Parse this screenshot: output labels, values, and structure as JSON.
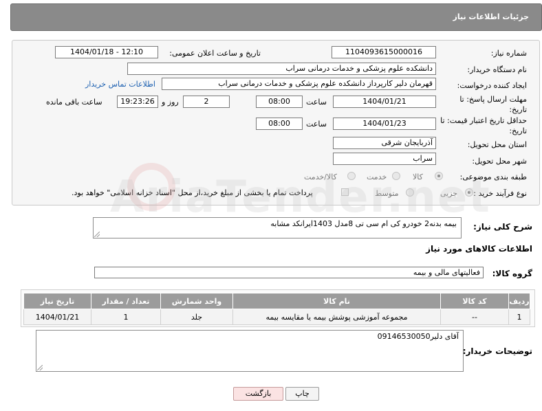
{
  "header": {
    "title": "جزئیات اطلاعات نیاز"
  },
  "form": {
    "need_number_label": "شماره نیاز:",
    "need_number": "1104093615000016",
    "announce_label": "تاریخ و ساعت اعلان عمومی:",
    "announce_value": "1404/01/18 - 12:10",
    "buyer_org_label": "نام دستگاه خریدار:",
    "buyer_org": "دانشکده علوم پزشکی و خدمات درمانی سراب",
    "requester_label": "ایجاد کننده درخواست:",
    "requester": "قهرمان دلیر کارپرداز دانشکده علوم پزشکی و خدمات درمانی سراب",
    "contact_link": "اطلاعات تماس خریدار",
    "reply_deadline_label": "مهلت ارسال پاسخ: تا تاریخ:",
    "reply_date": "1404/01/21",
    "time_label": "ساعت",
    "reply_time": "08:00",
    "days_value": "2",
    "days_label": "روز و",
    "remaining_time": "19:23:26",
    "remaining_label": "ساعت باقی مانده",
    "price_validity_label": "حداقل تاریخ اعتبار قیمت: تا تاریخ:",
    "price_date": "1404/01/23",
    "price_time": "08:00",
    "province_label": "استان محل تحویل:",
    "province": "آذربایجان شرقی",
    "city_label": "شهر محل تحویل:",
    "city": "سراب",
    "category_label": "طبقه بندی موضوعی:",
    "category_options": [
      "کالا",
      "خدمت",
      "کالا/خدمت"
    ],
    "purchase_type_label": "نوع فرآیند خرید :",
    "purchase_options": [
      "جزیی",
      "متوسط"
    ],
    "payment_note": "پرداخت تمام یا بخشی از مبلغ خرید،از محل \"اسناد خزانه اسلامی\" خواهد بود."
  },
  "description": {
    "label": "شرح کلی نیاز:",
    "text": "بیمه بدنه2 خودرو کی ام سی تی 8مدل  1403ایرانکد مشابه"
  },
  "goods": {
    "section_title": "اطلاعات کالاهای مورد نیاز",
    "group_label": "گروه کالا:",
    "group_value": "فعالیتهای مالی و بیمه",
    "columns": [
      "ردیف",
      "کد کالا",
      "نام کالا",
      "واحد شمارش",
      "تعداد / مقدار",
      "تاریخ نیاز"
    ],
    "rows": [
      [
        "1",
        "--",
        "مجموعه آموزشی پوشش بیمه یا مقایسه بیمه",
        "جلد",
        "1",
        "1404/01/21"
      ]
    ]
  },
  "buyer_notes": {
    "label": "توضیحات خریدار:",
    "text": "09146530050آقای دلیر"
  },
  "buttons": {
    "print": "چاپ",
    "back": "بازگشت"
  },
  "watermark": "AriaTender.net"
}
